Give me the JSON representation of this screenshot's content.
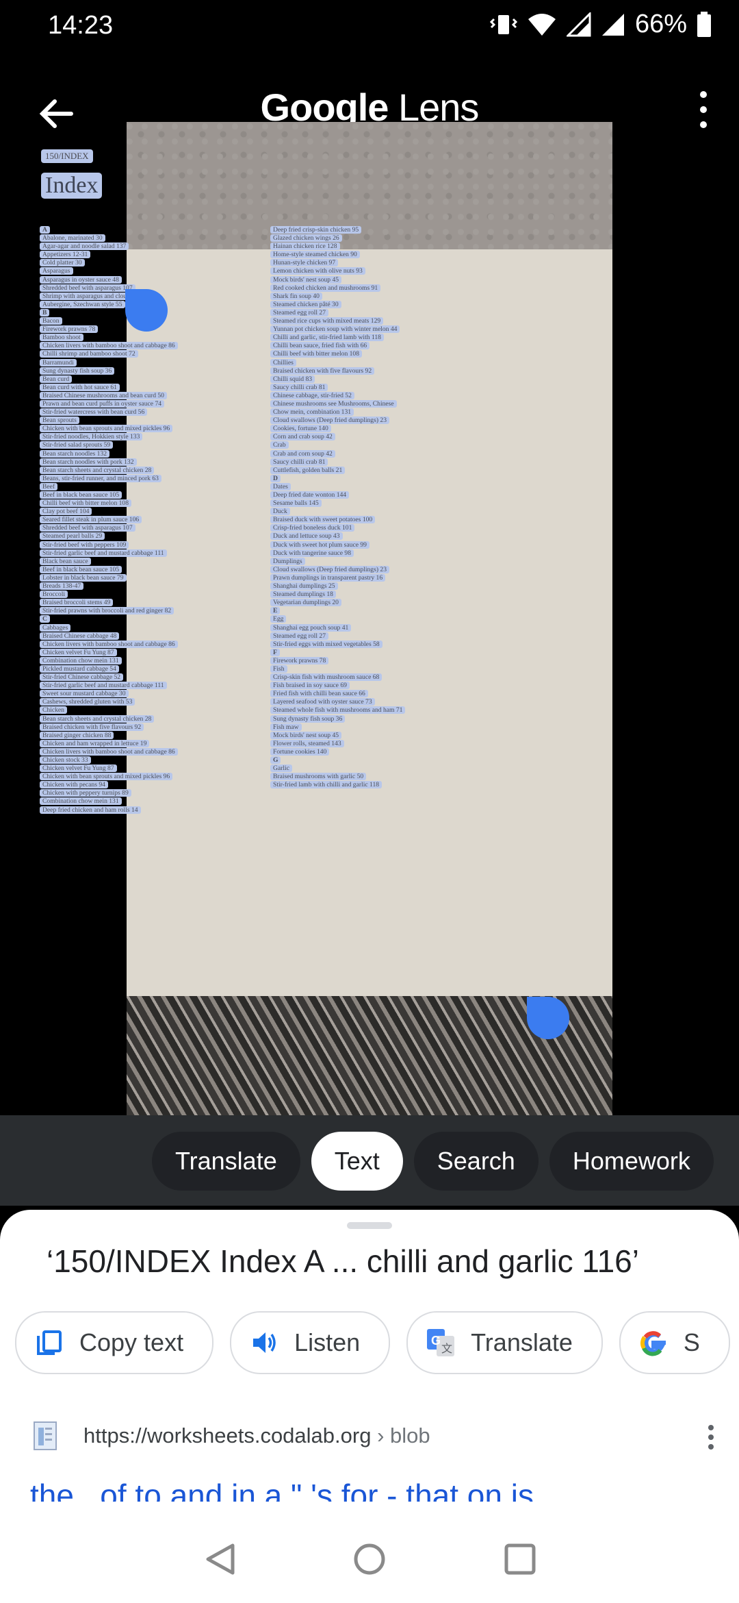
{
  "status": {
    "time": "14:23",
    "battery": "66%"
  },
  "header": {
    "title_brand": "Google",
    "title_product": "Lens"
  },
  "photo": {
    "label": "150/INDEX",
    "heading": "Index",
    "left_column": [
      "A",
      "Abalone, marinated 30",
      "Agar-agar and noodle salad 137",
      "Appetizers 12-31",
      "Cold platter 30",
      "Asparagus",
      "Asparagus in oyster sauce 48",
      "Shredded beef with asparagus 107",
      "Shrimp with asparagus and cloud ears 75",
      "Aubergine, Szechwan style 55",
      "B",
      "Bacon",
      "Firework prawns 78",
      "Bamboo shoot",
      "Chicken livers with bamboo shoot and cabbage 86",
      "Chilli shrimp and bamboo shoot 72",
      "Barramundi",
      "Sung dynasty fish soup 36",
      "Bean curd",
      "Bean curd with hot sauce 61",
      "Braised Chinese mushrooms and bean curd 50",
      "Prawn and bean curd puffs in oyster sauce 74",
      "Stir-fried watercress with bean curd 56",
      "Bean sprouts",
      "Chicken with bean sprouts and mixed pickles 96",
      "Stir-fried noodles, Hokkien style 133",
      "Stir-fried salad sprouts 59",
      "Bean starch noodles 132",
      "Bean starch noodles with pork 132",
      "Bean starch sheets and crystal chicken 28",
      "Beans, stir-fried runner, and minced pork 63",
      "Beef",
      "Beef in black bean sauce 105",
      "Chilli beef with bitter melon 108",
      "Clay pot beef 104",
      "Seared fillet steak in plum sauce 106",
      "Shredded beef with asparagus 107",
      "Steamed pearl balls 29",
      "Stir-fried beef with peppers 109",
      "Stir-fried garlic beef and mustard cabbage 111",
      "Black bean sauce",
      "Beef in black bean sauce 105",
      "Lobster in black bean sauce 79",
      "Breads 138-47",
      "Broccoli",
      "Braised broccoli stems 49",
      "Stir-fried prawns with broccoli and red ginger 82",
      "C",
      "Cabbages",
      "Braised Chinese cabbage 48",
      "Chicken livers with bamboo shoot and cabbage 86",
      "Chicken velvet Fu Yung 87",
      "Combination chow mein 131",
      "Pickled mustard cabbage 54",
      "Stir-fried Chinese cabbage 52",
      "Stir-fried garlic beef and mustard cabbage 111",
      "Sweet sour mustard cabbage 30",
      "Cashews, shredded gluten with 53",
      "Chicken",
      "Bean starch sheets and crystal chicken 28",
      "Braised chicken with five flavours 92",
      "Braised ginger chicken 88",
      "Chicken and ham wrapped in lettuce 19",
      "Chicken livers with bamboo shoot and cabbage 86",
      "Chicken stock 33",
      "Chicken velvet Fu Yung 87",
      "Chicken with bean sprouts and mixed pickles 96",
      "Chicken with pecans 94",
      "Chicken with peppery turnips 89",
      "Combination chow mein 131",
      "Deep fried chicken and ham rolls 14"
    ],
    "right_column": [
      "Deep fried crisp-skin chicken 95",
      "Glazed chicken wings 26",
      "Hainan chicken rice 128",
      "Home-style steamed chicken 90",
      "Hunan-style chicken 97",
      "Lemon chicken with olive nuts 93",
      "Mock birds' nest soup 45",
      "Red cooked chicken and mushrooms 91",
      "Shark fin soup 40",
      "Steamed chicken pâté 30",
      "Steamed egg roll 27",
      "Steamed rice cups with mixed meats 129",
      "Yunnan pot chicken soup with winter melon 44",
      "Chilli and garlic, stir-fried lamb with 118",
      "Chilli bean sauce, fried fish with 66",
      "Chilli beef with bitter melon 108",
      "Chillies",
      "Braised chicken with five flavours 92",
      "Chilli squid 83",
      "Saucy chilli crab 81",
      "Chinese cabbage, stir-fried 52",
      "Chinese mushrooms see Mushrooms, Chinese",
      "Chow mein, combination 131",
      "Cloud swallows (Deep fried dumplings) 23",
      "Cookies, fortune 140",
      "Corn and crab soup 42",
      "Crab",
      "Crab and corn soup 42",
      "Saucy chilli crab 81",
      "Cuttlefish, golden balls 21",
      "D",
      "Dates",
      "Deep fried date wonton 144",
      "Sesame balls 145",
      "Duck",
      "Braised duck with sweet potatoes 100",
      "Crisp-fried boneless duck 101",
      "Duck and lettuce soup 43",
      "Duck with sweet hot plum sauce 99",
      "Duck with tangerine sauce 98",
      "Dumplings",
      "Cloud swallows (Deep fried dumplings) 23",
      "Prawn dumplings in transparent pastry 16",
      "Shanghai dumplings 25",
      "Steamed dumplings 18",
      "Vegetarian dumplings 20",
      "E",
      "Egg",
      "Shanghai egg pouch soup 41",
      "Steamed egg roll 27",
      "Stir-fried eggs with mixed vegetables 58",
      "F",
      "Firework prawns 78",
      "Fish",
      "Crisp-skin fish with mushroom sauce 68",
      "Fish braised in soy sauce 69",
      "Fried fish with chilli bean sauce 66",
      "Layered seafood with oyster sauce 73",
      "Steamed whole fish with mushrooms and ham 71",
      "Sung dynasty fish soup 36",
      "Fish maw",
      "Mock birds' nest soup 45",
      "Flower rolls, steamed 143",
      "Fortune cookies 140",
      "G",
      "Garlic",
      "Braised mushrooms with garlic 50",
      "Stir-fried lamb with chilli and garlic 118"
    ]
  },
  "modes": [
    "Translate",
    "Text",
    "Search",
    "Homework"
  ],
  "active_mode": "Text",
  "result": {
    "extracted_text": "‘150/INDEX Index A ... chilli and garlic 116’",
    "actions": {
      "copy": "Copy text",
      "listen": "Listen",
      "translate": "Translate",
      "search": "S"
    },
    "source_url": "https://worksheets.codalab.org",
    "source_crumb": " › blob",
    "snippet": "the , of to and in a \" 's for - that on is"
  },
  "colors": {
    "accent": "#3b7cf0",
    "highlight": "#b8c7ea",
    "link": "#1a56d6"
  }
}
